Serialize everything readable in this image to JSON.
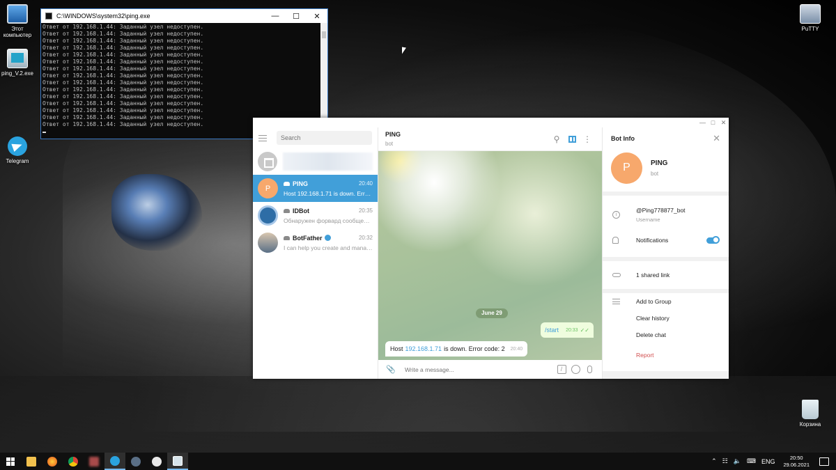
{
  "desktop": {
    "icons": [
      {
        "label": "Этот компьютер",
        "icon": "computer-icon"
      },
      {
        "label": "ping_V.2.exe",
        "icon": "exe-icon"
      },
      {
        "label": "Telegram",
        "icon": "telegram-icon"
      },
      {
        "label": "PuTTY",
        "icon": "putty-icon"
      },
      {
        "label": "Корзина",
        "icon": "recycle-bin-icon"
      }
    ]
  },
  "cmd": {
    "title": "C:\\WINDOWS\\system32\\ping.exe",
    "lines": [
      "Ответ от 192.168.1.44: Заданный узел недоступен.",
      "Ответ от 192.168.1.44: Заданный узел недоступен.",
      "Ответ от 192.168.1.44: Заданный узел недоступен.",
      "Ответ от 192.168.1.44: Заданный узел недоступен.",
      "Ответ от 192.168.1.44: Заданный узел недоступен.",
      "Ответ от 192.168.1.44: Заданный узел недоступен.",
      "Ответ от 192.168.1.44: Заданный узел недоступен.",
      "Ответ от 192.168.1.44: Заданный узел недоступен.",
      "Ответ от 192.168.1.44: Заданный узел недоступен.",
      "Ответ от 192.168.1.44: Заданный узел недоступен.",
      "Ответ от 192.168.1.44: Заданный узел недоступен.",
      "Ответ от 192.168.1.44: Заданный узел недоступен.",
      "Ответ от 192.168.1.44: Заданный узел недоступен.",
      "Ответ от 192.168.1.44: Заданный узел недоступен.",
      "Ответ от 192.168.1.44: Заданный узел недоступен."
    ]
  },
  "telegram": {
    "search_placeholder": "Search",
    "chats": [
      {
        "name": "PING",
        "time": "20:40",
        "preview": "Host 192.168.1.71 is down. Error c...",
        "avatar_letter": "P"
      },
      {
        "name": "IDBot",
        "time": "20:35",
        "preview": "Обнаружен форвард сообщени..."
      },
      {
        "name": "BotFather",
        "time": "20:32",
        "preview": "I can help you create and manag..."
      }
    ],
    "chat_header": {
      "title": "PING",
      "subtitle": "bot"
    },
    "date_label": "June 29",
    "messages": {
      "out": {
        "text": "/start",
        "time": "20:33"
      },
      "in": {
        "prefix": "Host",
        "link": "192.168.1.71",
        "suffix": "is down. Error code: 2",
        "time": "20:40"
      }
    },
    "input_placeholder": "Write a message...",
    "bot_info": {
      "title": "Bot Info",
      "name": "PING",
      "subtitle": "bot",
      "avatar_letter": "P",
      "username": "@Ping778877_bot",
      "username_label": "Username",
      "notifications_label": "Notifications",
      "shared_links": "1 shared link",
      "add_to_group": "Add to Group",
      "clear_history": "Clear history",
      "delete_chat": "Delete chat",
      "report": "Report"
    }
  },
  "taskbar": {
    "lang": "ENG",
    "time": "20:50",
    "date": "29.06.2021"
  }
}
